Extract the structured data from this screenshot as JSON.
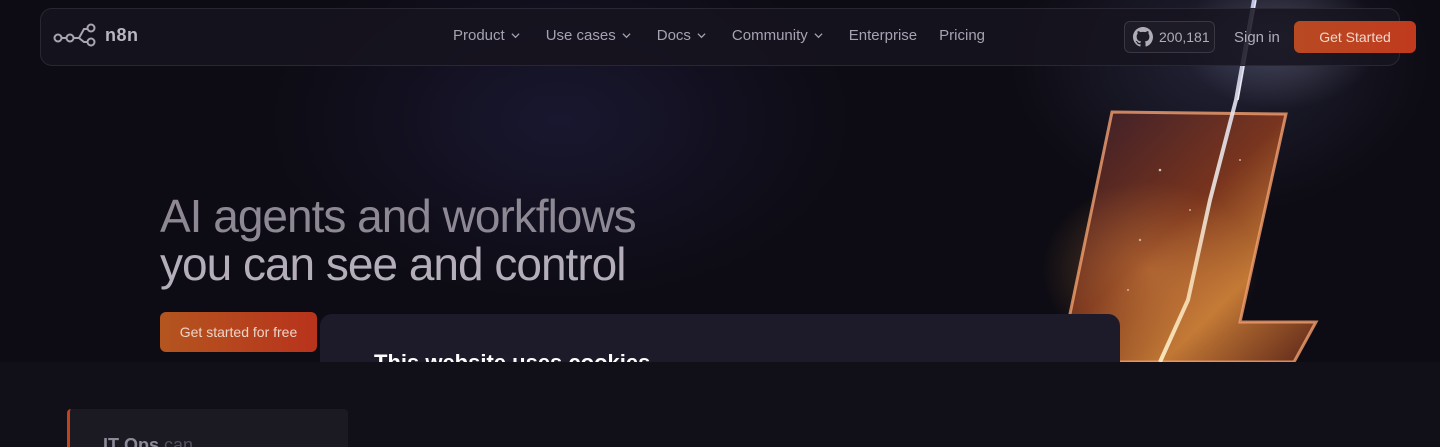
{
  "brand": {
    "name": "n8n"
  },
  "nav": {
    "items": [
      {
        "label": "Product",
        "has_dropdown": true
      },
      {
        "label": "Use cases",
        "has_dropdown": true
      },
      {
        "label": "Docs",
        "has_dropdown": true
      },
      {
        "label": "Community",
        "has_dropdown": true
      },
      {
        "label": "Enterprise",
        "has_dropdown": false
      },
      {
        "label": "Pricing",
        "has_dropdown": false
      }
    ],
    "github_stars": "200,181",
    "github_icon": "github-icon",
    "signin_label": "Sign in",
    "cta_label": "Get Started"
  },
  "hero": {
    "headline_line1": "AI agents and workflows",
    "headline_line2": "you can see and control",
    "cta_label": "Get started for free"
  },
  "cookie_banner": {
    "title": "This website uses cookies"
  },
  "card": {
    "strong": "IT Ops",
    "weak": " can"
  },
  "colors": {
    "background": "#0e0c15",
    "accent": "#c03a1e",
    "modal": "#1d1a2a"
  }
}
